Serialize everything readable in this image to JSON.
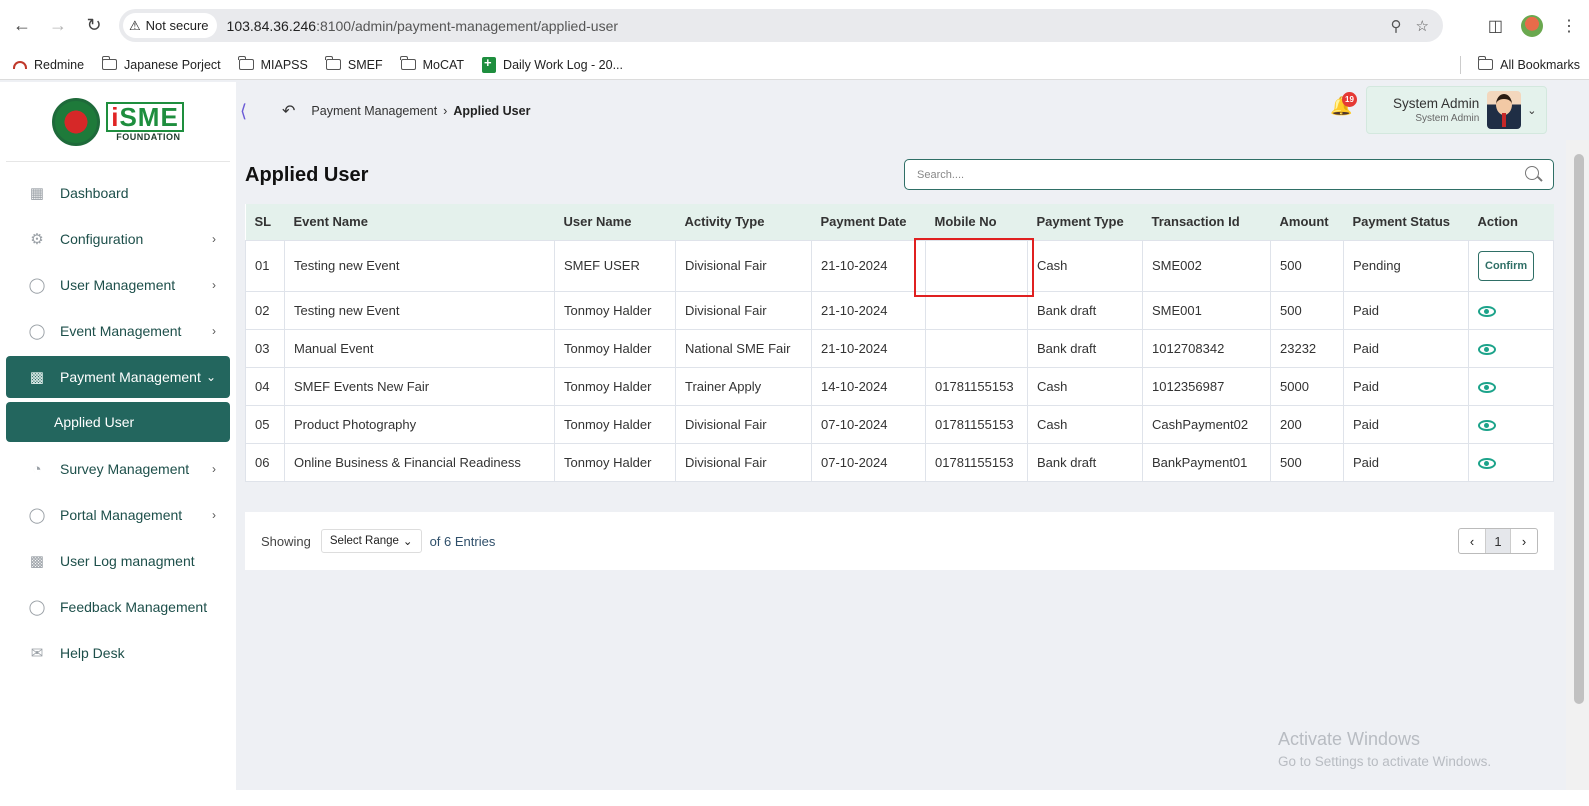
{
  "browser": {
    "security_label": "Not secure",
    "url_host": "103.84.36.246",
    "url_rest": ":8100/admin/payment-management/applied-user",
    "bookmarks": [
      "Redmine",
      "Japanese Porject",
      "MIAPSS",
      "SMEF",
      "MoCAT",
      "Daily Work Log - 20..."
    ],
    "all_bookmarks": "All Bookmarks"
  },
  "logo": {
    "brand": "SME",
    "sub": "FOUNDATION"
  },
  "sidebar": {
    "items": [
      {
        "label": "Dashboard",
        "icon": "grid-icon"
      },
      {
        "label": "Configuration",
        "icon": "config-icon"
      },
      {
        "label": "User Management",
        "icon": "user-shield-icon"
      },
      {
        "label": "Event Management",
        "icon": "event-icon"
      },
      {
        "label": "Payment Management",
        "icon": "payment-icon"
      },
      {
        "label": "Survey Management",
        "icon": "pie-icon"
      },
      {
        "label": "Portal Management",
        "icon": "portal-icon"
      },
      {
        "label": "User Log managment",
        "icon": "log-icon"
      },
      {
        "label": "Feedback Management",
        "icon": "feedback-icon"
      },
      {
        "label": "Help Desk",
        "icon": "mail-icon"
      }
    ],
    "subitem": "Applied User"
  },
  "header": {
    "breadcrumb_parent": "Payment Management",
    "breadcrumb_current": "Applied User",
    "notification_count": "19",
    "user_name": "System Admin",
    "user_role": "System Admin"
  },
  "main": {
    "title": "Applied User",
    "search_placeholder": "Search....",
    "columns": [
      "SL",
      "Event Name",
      "User Name",
      "Activity Type",
      "Payment Date",
      "Mobile No",
      "Payment Type",
      "Transaction Id",
      "Amount",
      "Payment Status",
      "Action"
    ],
    "rows": [
      {
        "sl": "01",
        "event": "Testing new Event",
        "user": "SMEF USER",
        "activity": "Divisional Fair",
        "date": "21-10-2024",
        "mobile": "",
        "ptype": "Cash",
        "txn": "SME002",
        "amount": "500",
        "status": "Pending",
        "action": "Confirm"
      },
      {
        "sl": "02",
        "event": "Testing new Event",
        "user": "Tonmoy Halder",
        "activity": "Divisional Fair",
        "date": "21-10-2024",
        "mobile": "",
        "ptype": "Bank draft",
        "txn": "SME001",
        "amount": "500",
        "status": "Paid",
        "action": "view"
      },
      {
        "sl": "03",
        "event": "Manual Event",
        "user": "Tonmoy Halder",
        "activity": "National SME Fair",
        "date": "21-10-2024",
        "mobile": "",
        "ptype": "Bank draft",
        "txn": "1012708342",
        "amount": "23232",
        "status": "Paid",
        "action": "view"
      },
      {
        "sl": "04",
        "event": "SMEF Events New Fair",
        "user": "Tonmoy Halder",
        "activity": "Trainer Apply",
        "date": "14-10-2024",
        "mobile": "01781155153",
        "ptype": "Cash",
        "txn": "1012356987",
        "amount": "5000",
        "status": "Paid",
        "action": "view"
      },
      {
        "sl": "05",
        "event": "Product Photography",
        "user": "Tonmoy Halder",
        "activity": "Divisional Fair",
        "date": "07-10-2024",
        "mobile": "01781155153",
        "ptype": "Cash",
        "txn": "CashPayment02",
        "amount": "200",
        "status": "Paid",
        "action": "view"
      },
      {
        "sl": "06",
        "event": "Online Business & Financial Readiness",
        "user": "Tonmoy Halder",
        "activity": "Divisional Fair",
        "date": "07-10-2024",
        "mobile": "01781155153",
        "ptype": "Bank draft",
        "txn": "BankPayment01",
        "amount": "500",
        "status": "Paid",
        "action": "view"
      }
    ],
    "footer": {
      "showing": "Showing",
      "range": "Select Range",
      "entries": "of 6 Entries",
      "page": "1"
    }
  },
  "watermark": {
    "line1": "Activate Windows",
    "line2": "Go to Settings to activate Windows."
  },
  "colors": {
    "primary": "#23665e",
    "header_row": "#e4f1ec",
    "highlight": "#e02020"
  }
}
